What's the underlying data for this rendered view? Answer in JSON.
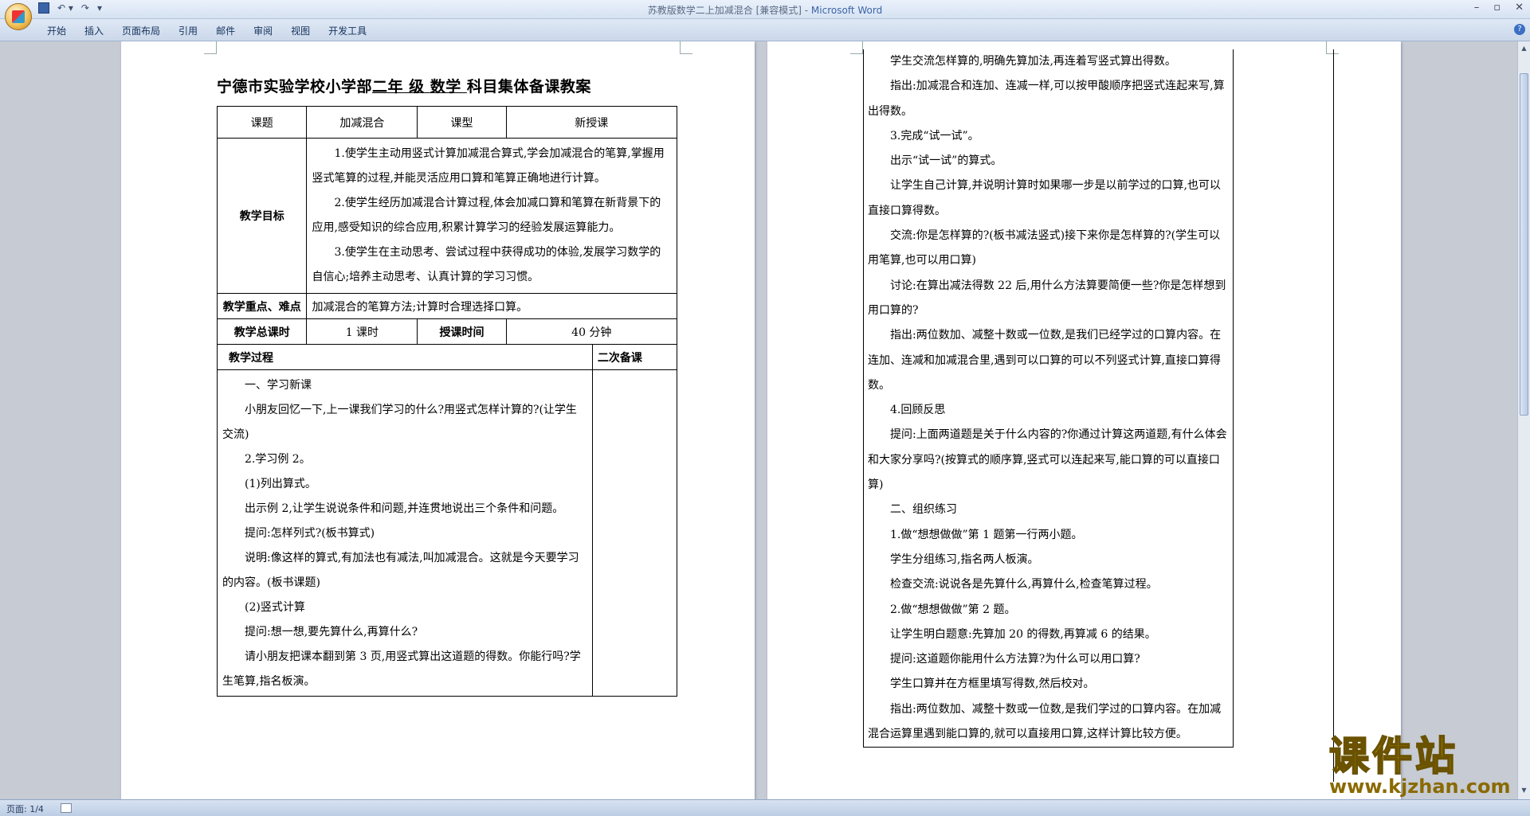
{
  "window": {
    "doc_name": "苏教版数学二上加减混合 [兼容模式] - ",
    "app_name": "Microsoft Word"
  },
  "ribbon": {
    "tabs": [
      "开始",
      "插入",
      "页面布局",
      "引用",
      "邮件",
      "审阅",
      "视图",
      "开发工具"
    ]
  },
  "page1": {
    "heading_prefix": "宁德市实验学校小学部",
    "heading_grade": "二年",
    "heading_mid": " 级 ",
    "heading_subject": " 数学 ",
    "heading_suffix": "科目集体备课教案",
    "table": {
      "lesson_label": "课题",
      "lesson_value": "加减混合",
      "type_label": "课型",
      "type_value": "新授课",
      "goals_label": "教学目标",
      "goals": [
        "1.使学生主动用竖式计算加减混合算式,学会加减混合的笔算,掌握用竖式笔算的过程,并能灵活应用口算和笔算正确地进行计算。",
        "2.使学生经历加减混合计算过程,体会加减口算和笔算在新背景下的应用,感受知识的综合应用,积累计算学习的经验发展运算能力。",
        "3.使学生在主动思考、尝试过程中获得成功的体验,发展学习数学的自信心;培养主动思考、认真计算的学习习惯。"
      ],
      "key_label": "教学重点、难点",
      "key_value": "加减混合的笔算方法;计算时合理选择口算。",
      "hours_label": "教学总课时",
      "hours_value": "1 课时",
      "time_label": "授课时间",
      "time_value": "40 分钟",
      "process_label": "教学过程",
      "second_label": "二次备课",
      "process": [
        "一、学习新课",
        "小朋友回忆一下,上一课我们学习的什么?用竖式怎样计算的?(让学生交流)",
        "2.学习例 2。",
        "(1)列出算式。",
        "出示例 2,让学生说说条件和问题,并连贯地说出三个条件和问题。",
        "提问:怎样列式?(板书算式)",
        "说明:像这样的算式,有加法也有减法,叫加减混合。这就是今天要学习的内容。(板书课题)",
        "(2)竖式计算",
        "提问:想一想,要先算什么,再算什么?",
        "请小朋友把课本翻到第 3 页,用竖式算出这道题的得数。你能行吗?学生笔算,指名板演。"
      ]
    }
  },
  "page2": {
    "paragraphs": [
      "学生交流怎样算的,明确先算加法,再连着写竖式算出得数。",
      "指出:加减混合和连加、连减一样,可以按甲酸顺序把竖式连起来写,算出得数。",
      "3.完成“试一试”。",
      "出示“试一试”的算式。",
      "让学生自己计算,并说明计算时如果哪一步是以前学过的口算,也可以直接口算得数。",
      "交流:你是怎样算的?(板书减法竖式)接下来你是怎样算的?(学生可以用笔算,也可以用口算)",
      "讨论:在算出减法得数 22 后,用什么方法算要简便一些?你是怎样想到用口算的?",
      "指出:两位数加、减整十数或一位数,是我们已经学过的口算内容。在连加、连减和加减混合里,遇到可以口算的可以不列竖式计算,直接口算得数。",
      "4.回顾反思",
      "提问:上面两道题是关于什么内容的?你通过计算这两道题,有什么体会和大家分享吗?(按算式的顺序算,竖式可以连起来写,能口算的可以直接口算)",
      "二、组织练习",
      "1.做“想想做做”第 1 题第一行两小题。",
      "学生分组练习,指名两人板演。",
      "检查交流:说说各是先算什么,再算什么,检查笔算过程。",
      "2.做“想想做做”第 2 题。",
      "让学生明白题意:先算加 20 的得数,再算减 6 的结果。",
      "提问:这道题你能用什么方法算?为什么可以用口算?",
      "学生口算并在方框里填写得数,然后校对。",
      "指出:两位数加、减整十数或一位数,是我们学过的口算内容。在加减混合运算里遇到能口算的,就可以直接用口算,这样计算比较方便。"
    ]
  },
  "statusbar": {
    "page_info": "页面: 1/4"
  },
  "watermark": {
    "cn": "课件站",
    "en": "www.kjzhan.com"
  }
}
